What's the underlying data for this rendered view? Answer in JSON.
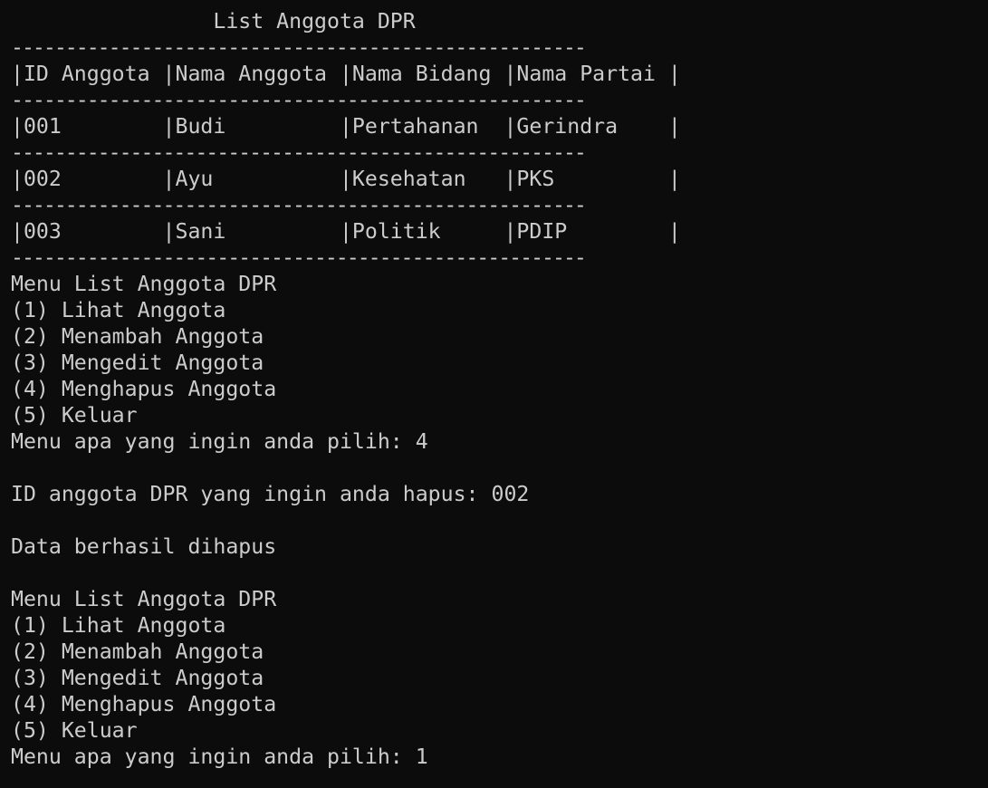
{
  "terminal": {
    "lines": [
      "                List Anggota DPR",
      "-----------------------------------------------------",
      "|ID Anggota |Nama Anggota |Nama Bidang |Nama Partai |",
      "-----------------------------------------------------",
      "|001        |Budi         |Pertahanan  |Gerindra    |",
      "-----------------------------------------------------",
      "|002        |Ayu          |Kesehatan   |PKS         |",
      "-----------------------------------------------------",
      "|003        |Sani         |Politik     |PDIP        |",
      "-----------------------------------------------------",
      "Menu List Anggota DPR",
      "(1) Lihat Anggota",
      "(2) Menambah Anggota",
      "(3) Mengedit Anggota",
      "(4) Menghapus Anggota",
      "(5) Keluar",
      "Menu apa yang ingin anda pilih: 4",
      "",
      "ID anggota DPR yang ingin anda hapus: 002",
      "",
      "Data berhasil dihapus",
      "",
      "Menu List Anggota DPR",
      "(1) Lihat Anggota",
      "(2) Menambah Anggota",
      "(3) Mengedit Anggota",
      "(4) Menghapus Anggota",
      "(5) Keluar",
      "Menu apa yang ingin anda pilih: 1"
    ]
  }
}
